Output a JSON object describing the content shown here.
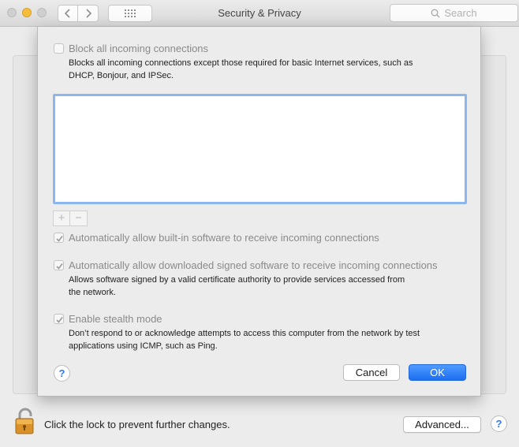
{
  "window": {
    "title": "Security & Privacy",
    "search_placeholder": "Search"
  },
  "icons": {
    "back": "chevron-left-icon",
    "forward": "chevron-right-icon",
    "grid": "grid-icon",
    "search": "search-icon",
    "lock": "lock-icon",
    "checkmark": "checkmark-icon"
  },
  "colors": {
    "accent": "#1c6ff0",
    "minimize": "#f5bd3a",
    "list_focus": "#8bb6ef"
  },
  "sheet": {
    "block_all": {
      "label": "Block all incoming connections",
      "checked": false,
      "description_line1": "Blocks all incoming connections except those required for basic Internet services, such as",
      "description_line2": "DHCP, Bonjour, and IPSec."
    },
    "list_controls": {
      "add": "+",
      "remove": "−"
    },
    "auto_builtin": {
      "label": "Automatically allow built-in software to receive incoming connections",
      "checked": true
    },
    "auto_signed": {
      "label": "Automatically allow downloaded signed software to receive incoming connections",
      "checked": true,
      "description_line1": "Allows software signed by a valid certificate authority to provide services accessed from",
      "description_line2": "the network."
    },
    "stealth": {
      "label": "Enable stealth mode",
      "checked": true,
      "description_line1": "Don’t respond to or acknowledge attempts to access this computer from the network by test",
      "description_line2": "applications using ICMP, such as Ping."
    },
    "help": "?",
    "cancel": "Cancel",
    "ok": "OK"
  },
  "footer": {
    "lock_text": "Click the lock to prevent further changes.",
    "advanced": "Advanced...",
    "help": "?"
  }
}
